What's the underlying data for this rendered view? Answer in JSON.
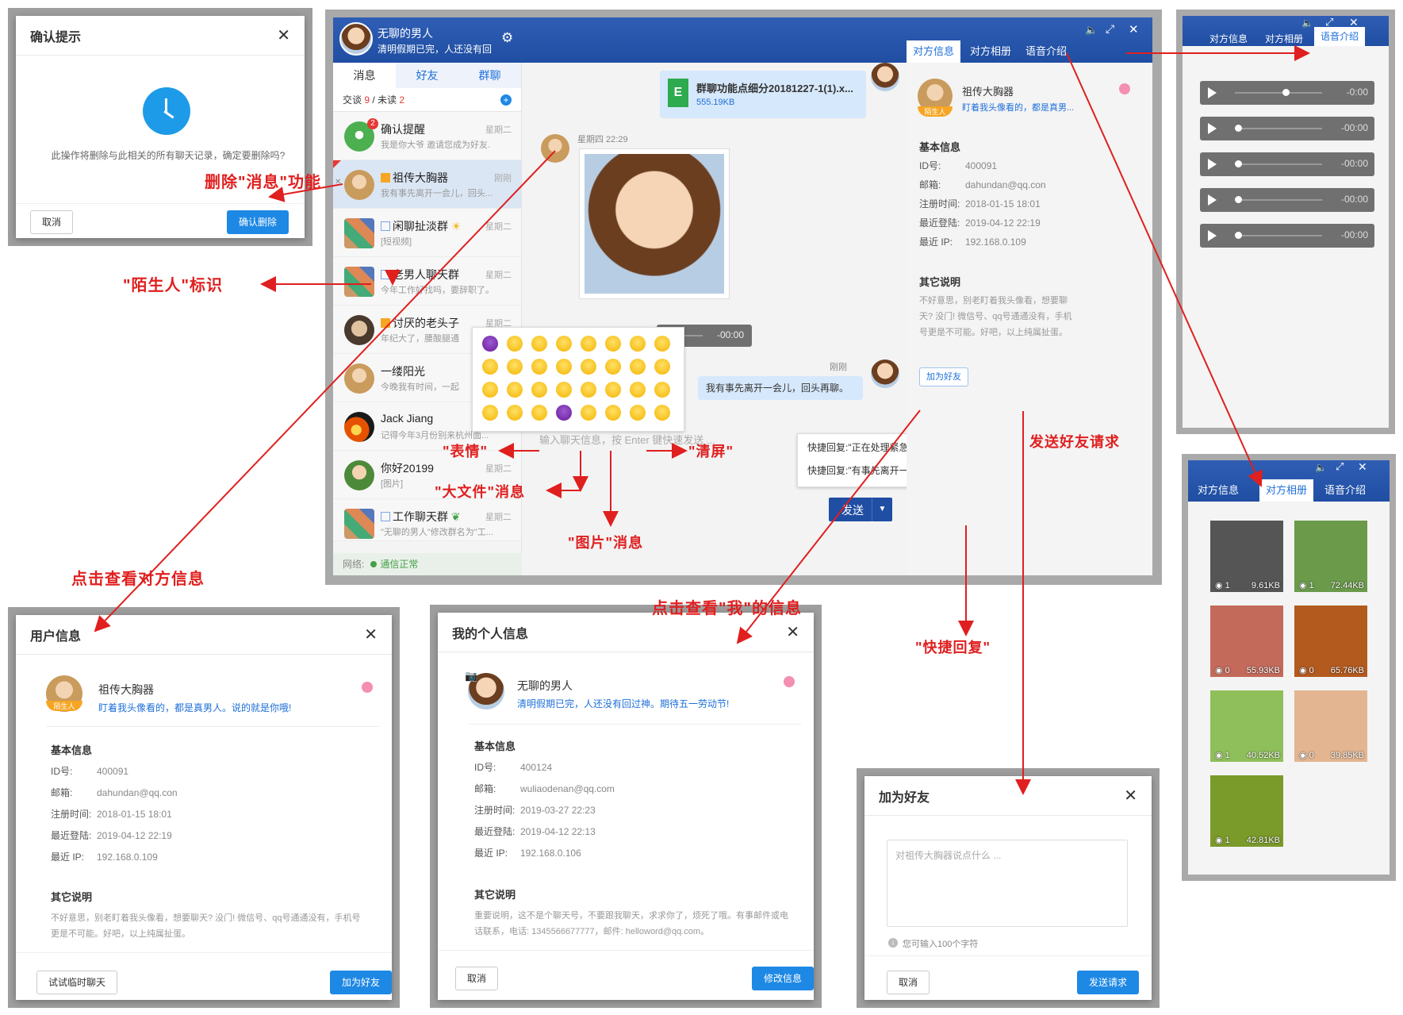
{
  "confirm_dialog": {
    "title": "确认提示",
    "message": "此操作将删除与此相关的所有聊天记录，确定要删除吗?",
    "cancel": "取消",
    "confirm": "确认删除"
  },
  "main_window": {
    "user_name": "无聊的男人",
    "user_signature": "清明假期已完，人还没有回",
    "tabs": [
      "消息",
      "好友",
      "群聊"
    ],
    "counts": {
      "talk_label": "交谈",
      "talk": "9",
      "unread_label": "未读",
      "unread": "2"
    },
    "conversations": [
      {
        "name": "确认提醒",
        "preview": "我是你大爷 邀请您成为好友.",
        "time": "星期二",
        "badge": "2"
      },
      {
        "name": "祖传大胸器",
        "preview": "我有事先离开一会儿，回头...",
        "time": "刚刚"
      },
      {
        "name": "闲聊扯淡群",
        "preview": "[短视频]",
        "time": "星期二"
      },
      {
        "name": "老男人聊天群",
        "preview": "今年工作好找吗，要辞职了。",
        "time": "星期二"
      },
      {
        "name": "讨厌的老头子",
        "preview": "年纪大了，腰酸腿通",
        "time": "星期二"
      },
      {
        "name": "一缕阳光",
        "preview": "今晚我有时间，一起",
        "time": ""
      },
      {
        "name": "Jack Jiang",
        "preview": "记得今年3月份别来杭州面...",
        "time": ""
      },
      {
        "name": "你好20199",
        "preview": "[图片]",
        "time": "星期二"
      },
      {
        "name": "工作聊天群",
        "preview": "\"无聊的男人\"修改群名为\"工...",
        "time": "星期二"
      }
    ],
    "status_label": "网络:",
    "status_value": "通信正常",
    "file_name": "群聊功能点细分20181227-1(1).x...",
    "file_size": "555.19KB",
    "msg_time": "星期四 22:29",
    "voice_dur": "-00:00",
    "msg_time2": "刚刚",
    "msg_text": "我有事先离开一会儿，回头再聊。",
    "input_placeholder": "输入聊天信息，按 Enter 键快速发送 ...",
    "quick_reply_1": "快捷回复:\"正在处理紧急事情\"",
    "quick_reply_2": "快捷回复:\"有事先离开一会儿\"",
    "send": "发送",
    "right_tabs": [
      "对方信息",
      "对方相册",
      "语音介绍"
    ],
    "peer_name": "祖传大胸器",
    "peer_sig": "盯着我头像看的，都是真男...",
    "stranger_tag": "陌生人",
    "basic_info": "基本信息",
    "other_info": "其它说明",
    "fields": [
      {
        "k": "ID号:",
        "v": "400091"
      },
      {
        "k": "邮箱:",
        "v": "dahundan@qq.con"
      },
      {
        "k": "注册时间:",
        "v": "2018-01-15 18:01"
      },
      {
        "k": "最近登陆:",
        "v": "2019-04-12 22:19"
      },
      {
        "k": "最近 IP:",
        "v": "192.168.0.109"
      }
    ],
    "other_desc": "不好意思，别老盯着我头像看，想要聊天? 没门! 微信号、qq号通通没有，手机号更是不可能。好吧，以上纯属扯蛋。",
    "add_friend": "加为好友"
  },
  "voice_panel": {
    "tabs": [
      "对方信息",
      "对方相册",
      "语音介绍"
    ],
    "items": [
      {
        "dur": "-0:00",
        "level": 0.55
      },
      {
        "dur": "-00:00",
        "level": 0.0
      },
      {
        "dur": "-00:00",
        "level": 0.0
      },
      {
        "dur": "-00:00",
        "level": 0.0
      },
      {
        "dur": "-00:00",
        "level": 0.0
      }
    ]
  },
  "album_panel": {
    "tabs": [
      "对方信息",
      "对方相册",
      "语音介绍"
    ],
    "photos": [
      {
        "cnt": "1",
        "size": "9.61KB",
        "color": "#555"
      },
      {
        "cnt": "1",
        "size": "72.44KB",
        "color": "#6a9a4a"
      },
      {
        "cnt": "0",
        "size": "55.93KB",
        "color": "#c46a5a"
      },
      {
        "cnt": "0",
        "size": "65.76KB",
        "color": "#b35a1f"
      },
      {
        "cnt": "1",
        "size": "40.52KB",
        "color": "#8fbf5a"
      },
      {
        "cnt": "0",
        "size": "39.85KB",
        "color": "#e3b590"
      },
      {
        "cnt": "1",
        "size": "42.81KB",
        "color": "#7a9a2a"
      }
    ]
  },
  "user_info_dialog": {
    "title": "用户信息",
    "name": "祖传大胸器",
    "sig": "盯着我头像看的，都是真男人。说的就是你哦!",
    "tag": "陌生人",
    "basic": "基本信息",
    "fields": [
      {
        "k": "ID号:",
        "v": "400091"
      },
      {
        "k": "邮箱:",
        "v": "dahundan@qq.con"
      },
      {
        "k": "注册时间:",
        "v": "2018-01-15 18:01"
      },
      {
        "k": "最近登陆:",
        "v": "2019-04-12 22:19"
      },
      {
        "k": "最近 IP:",
        "v": "192.168.0.109"
      }
    ],
    "other": "其它说明",
    "desc": "不好意思，别老盯着我头像看，想要聊天? 没门! 微信号、qq号通通没有，手机号更是不可能。好吧，以上纯属扯蛋。",
    "btn_temp": "试试临时聊天",
    "btn_add": "加为好友"
  },
  "my_info_dialog": {
    "title": "我的个人信息",
    "name": "无聊的男人",
    "sig": "清明假期已完，人还没有回过神。期待五一劳动节!",
    "basic": "基本信息",
    "fields": [
      {
        "k": "ID号:",
        "v": "400124"
      },
      {
        "k": "邮箱:",
        "v": "wuliaodenan@qq.com"
      },
      {
        "k": "注册时间:",
        "v": "2019-03-27 22:23"
      },
      {
        "k": "最近登陆:",
        "v": "2019-04-12 22:13"
      },
      {
        "k": "最近 IP:",
        "v": "192.168.0.106"
      }
    ],
    "other": "其它说明",
    "desc": "重要说明，这不是个聊天号，不要跟我聊天，求求你了，烦死了哦。有事邮件或电话联系，电话: 1345566677777，邮件: helloword@qq.com。",
    "cancel": "取消",
    "edit": "修改信息"
  },
  "add_friend_dialog": {
    "title": "加为好友",
    "placeholder": "对祖传大胸器说点什么 ...",
    "hint": "您可输入100个字符",
    "cancel": "取消",
    "send": "发送请求"
  },
  "annotations": {
    "delete_msg": "删除\"消息\"功能",
    "stranger": "\"陌生人\"标识",
    "view_peer": "点击查看对方信息",
    "emoji": "\"表情\"",
    "bigfile": "\"大文件\"消息",
    "image": "\"图片\"消息",
    "clear": "\"清屏\"",
    "add_request": "发送好友请求",
    "view_me": "点击查看\"我\"的信息",
    "quick_reply": "\"快捷回复\""
  }
}
